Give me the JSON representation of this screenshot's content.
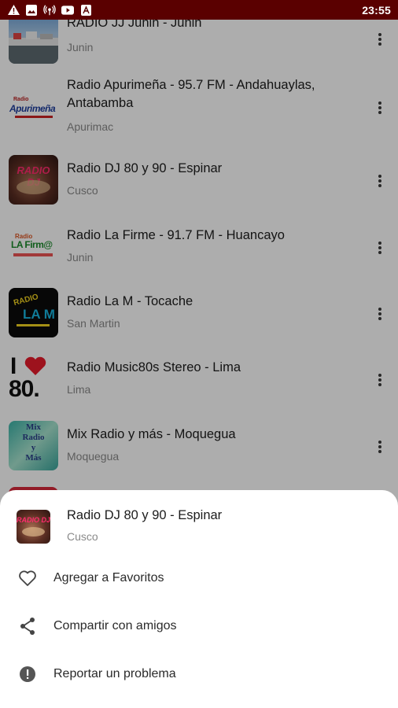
{
  "status_bar": {
    "time": "23:55",
    "icons": [
      "warning-icon",
      "image-icon",
      "radio-broadcast-icon",
      "youtube-icon",
      "app-icon"
    ]
  },
  "stations": [
    {
      "title": "RADIO JJ Junin - Junin",
      "region": "Junin"
    },
    {
      "title": "Radio Apurimeña - 95.7 FM - Andahuaylas, Antabamba",
      "region": "Apurimac"
    },
    {
      "title": "Radio DJ 80 y 90 - Espinar",
      "region": "Cusco"
    },
    {
      "title": "Radio La Firme - 91.7 FM - Huancayo",
      "region": "Junin"
    },
    {
      "title": "Radio La M - Tocache",
      "region": "San Martin"
    },
    {
      "title": "Radio Music80s Stereo - Lima",
      "region": "Lima"
    },
    {
      "title": "Mix Radio y más - Moquegua",
      "region": "Moquegua"
    }
  ],
  "logos": {
    "apurimena": {
      "line1": "Radio",
      "line2": "Apurimeña"
    },
    "dj": "RADIO DJ",
    "lafirme": {
      "line1": "Radio",
      "line2": "LA Firm@"
    },
    "lam": {
      "line1": "RADIO",
      "line2": "LA M"
    },
    "music80s": {
      "line1": "I",
      "line2": "80."
    },
    "mix": {
      "line1": "Mix",
      "line2": "Radio",
      "line3": "y",
      "line4": "Más"
    }
  },
  "sheet": {
    "title": "Radio DJ 80 y 90 - Espinar",
    "subtitle": "Cusco",
    "actions": [
      {
        "label": "Agregar a Favoritos",
        "icon": "heart-icon"
      },
      {
        "label": "Compartir con amigos",
        "icon": "share-icon"
      },
      {
        "label": "Reportar un problema",
        "icon": "report-icon"
      }
    ]
  },
  "colors": {
    "status_bar": "#5a0000",
    "title_text": "#1c1c1c",
    "subtitle_text": "#8a8a8a",
    "scrim": "rgba(0,0,0,0.32)"
  }
}
